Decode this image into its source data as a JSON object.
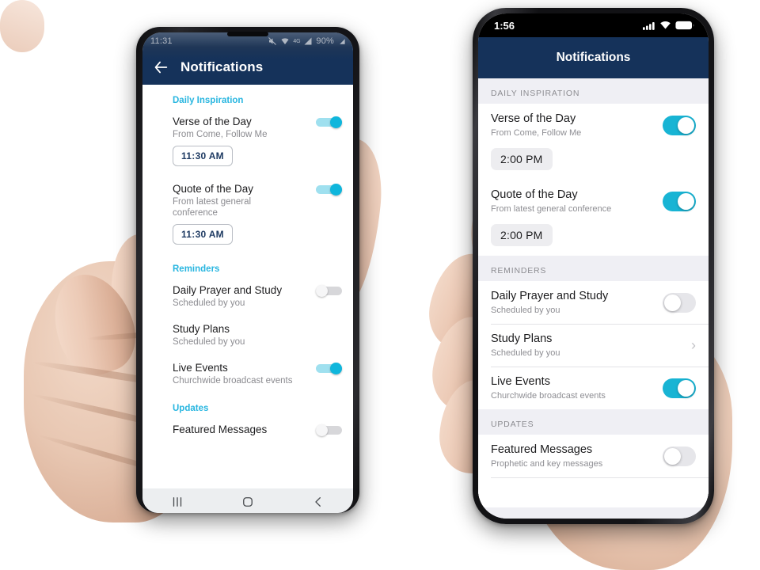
{
  "theme": {
    "header_navy": "#15325a",
    "accent_cyan": "#18b4d4",
    "android_section_cyan": "#29b6e0",
    "page_background": "#ffffff",
    "ios_group_background": "#efeff4"
  },
  "android_phone": {
    "status_bar": {
      "time": "11:31",
      "battery_percent": "90%",
      "icons": [
        "mute-icon",
        "wifi-icon",
        "network-4g-icon",
        "signal-icon",
        "battery-icon"
      ],
      "network_label": "4G"
    },
    "app_bar": {
      "back_label": "Back",
      "title": "Notifications"
    },
    "sections": [
      {
        "label": "Daily Inspiration",
        "rows": [
          {
            "title": "Verse of the Day",
            "subtitle": "From Come, Follow Me",
            "toggle": "on",
            "time_chip": "11:30 AM"
          },
          {
            "title": "Quote of the Day",
            "subtitle": "From latest general conference",
            "toggle": "on",
            "time_chip": "11:30 AM"
          }
        ]
      },
      {
        "label": "Reminders",
        "rows": [
          {
            "title": "Daily Prayer and Study",
            "subtitle": "Scheduled by you",
            "toggle": "off",
            "time_chip": ""
          },
          {
            "title": "Study Plans",
            "subtitle": "Scheduled by you",
            "toggle": "none",
            "time_chip": ""
          },
          {
            "title": "Live Events",
            "subtitle": "Churchwide broadcast events",
            "toggle": "on",
            "time_chip": ""
          }
        ]
      },
      {
        "label": "Updates",
        "rows": [
          {
            "title": "Featured Messages",
            "subtitle": "",
            "toggle": "off",
            "time_chip": ""
          }
        ]
      }
    ],
    "nav_bar": {
      "recents_label": "Recents",
      "home_label": "Home",
      "back_label": "Back"
    }
  },
  "ios_phone": {
    "status_bar": {
      "time": "1:56",
      "icons": [
        "cellular-signal-icon",
        "wifi-icon",
        "battery-icon"
      ]
    },
    "app_bar": {
      "title": "Notifications"
    },
    "sections": [
      {
        "label": "DAILY INSPIRATION",
        "rows": [
          {
            "title": "Verse of the Day",
            "subtitle": "From Come, Follow Me",
            "toggle": "on",
            "time_chip": "2:00 PM",
            "chevron": false
          },
          {
            "title": "Quote of the Day",
            "subtitle": "From latest general conference",
            "toggle": "on",
            "time_chip": "2:00 PM",
            "chevron": false
          }
        ]
      },
      {
        "label": "REMINDERS",
        "rows": [
          {
            "title": "Daily Prayer and Study",
            "subtitle": "Scheduled by you",
            "toggle": "off",
            "time_chip": "",
            "chevron": false
          },
          {
            "title": "Study Plans",
            "subtitle": "Scheduled by you",
            "toggle": "none",
            "time_chip": "",
            "chevron": true
          },
          {
            "title": "Live Events",
            "subtitle": "Churchwide broadcast events",
            "toggle": "on",
            "time_chip": "",
            "chevron": false
          }
        ]
      },
      {
        "label": "UPDATES",
        "rows": [
          {
            "title": "Featured Messages",
            "subtitle": "Prophetic and key messages",
            "toggle": "off",
            "time_chip": "",
            "chevron": false
          }
        ]
      }
    ]
  }
}
